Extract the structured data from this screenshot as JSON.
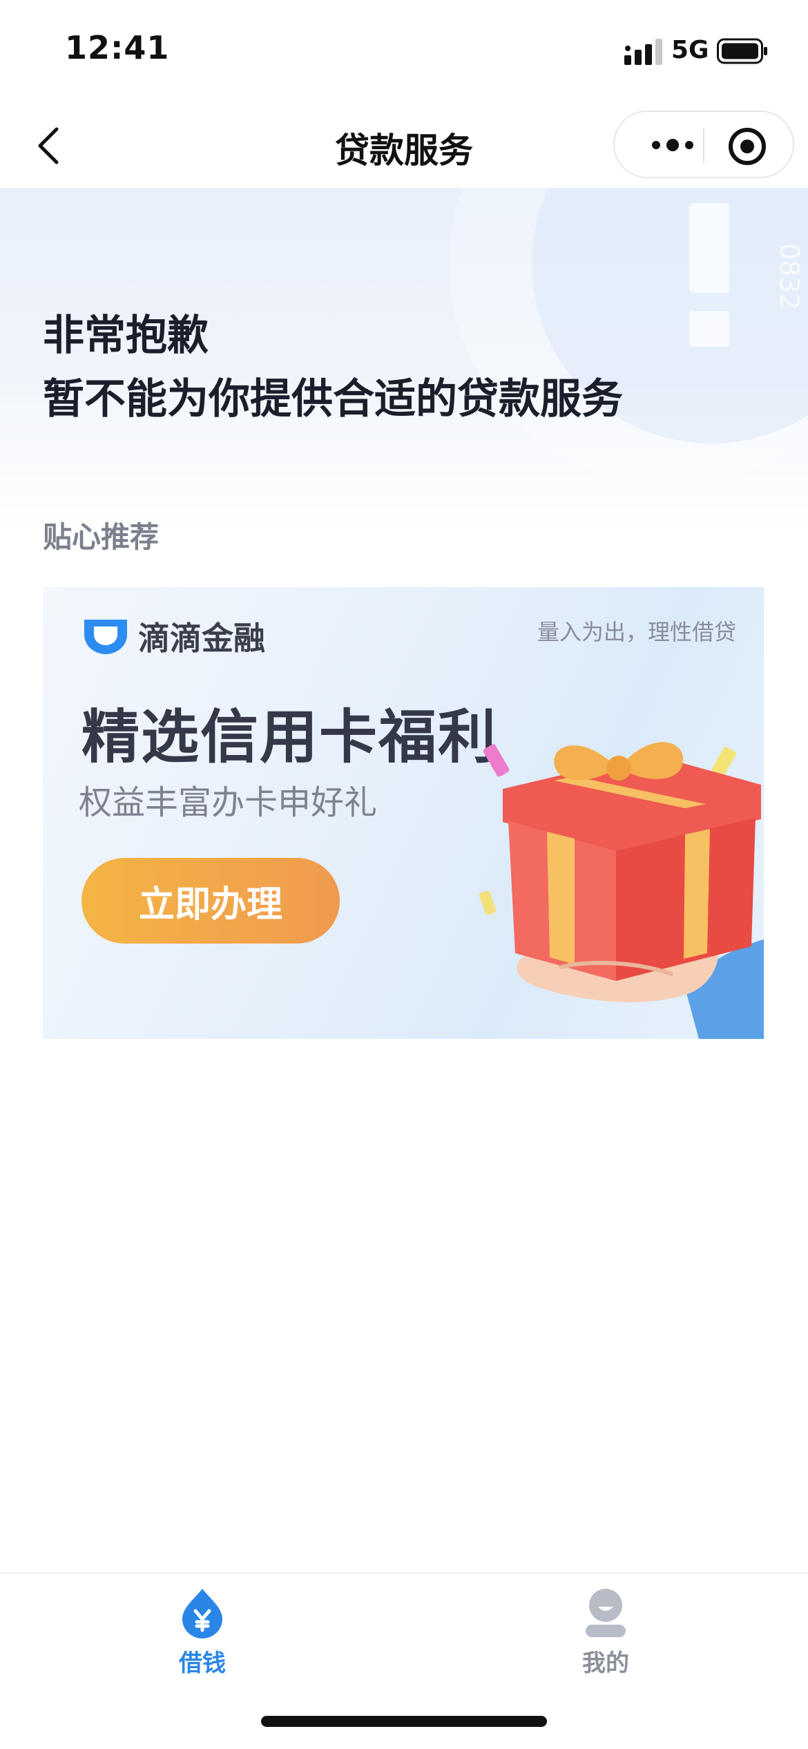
{
  "status_bar": {
    "time": "12:41",
    "network": "5G"
  },
  "nav": {
    "title": "贷款服务"
  },
  "hero": {
    "line1": "非常抱歉",
    "line2": "暂不能为你提供合适的贷款服务",
    "deco_code": "0832"
  },
  "recommend": {
    "label": "贴心推荐"
  },
  "banner": {
    "brand": "滴滴金融",
    "slogan": "量入为出，理性借贷",
    "title": "精选信用卡福利",
    "subtitle": "权益丰富办卡申好礼",
    "cta": "立即办理"
  },
  "tabs": [
    {
      "label": "借钱",
      "icon": "yuan-drop-icon",
      "active": true
    },
    {
      "label": "我的",
      "icon": "user-icon",
      "active": false
    }
  ],
  "colors": {
    "accent": "#2a86e6",
    "cta_start": "#f4b545",
    "cta_end": "#f09a4e"
  }
}
